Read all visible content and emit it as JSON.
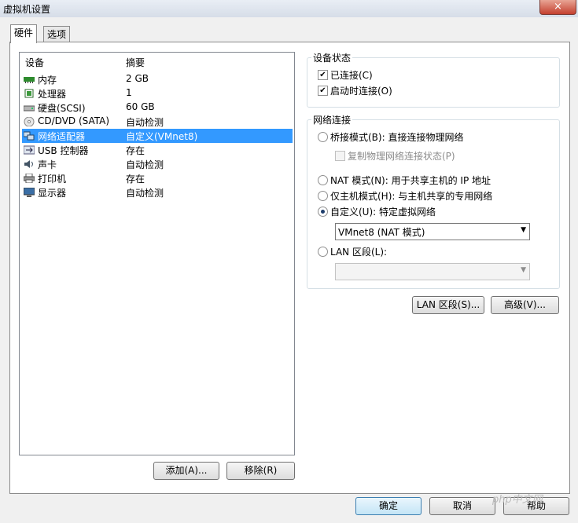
{
  "window": {
    "title": "虚拟机设置",
    "close_icon": "×"
  },
  "tabs": [
    {
      "label": "硬件",
      "active": true
    },
    {
      "label": "选项",
      "active": false
    }
  ],
  "device_list": {
    "headers": {
      "device": "设备",
      "summary": "摘要"
    },
    "rows": [
      {
        "icon": "memory-icon",
        "name": "内存",
        "summary": "2 GB"
      },
      {
        "icon": "processor-icon",
        "name": "处理器",
        "summary": "1"
      },
      {
        "icon": "harddisk-icon",
        "name": "硬盘(SCSI)",
        "summary": "60 GB"
      },
      {
        "icon": "cd-dvd-icon",
        "name": "CD/DVD (SATA)",
        "summary": "自动检测"
      },
      {
        "icon": "network-adapter-icon",
        "name": "网络适配器",
        "summary": "自定义(VMnet8)",
        "selected": true
      },
      {
        "icon": "usb-icon",
        "name": "USB 控制器",
        "summary": "存在"
      },
      {
        "icon": "sound-card-icon",
        "name": "声卡",
        "summary": "自动检测"
      },
      {
        "icon": "printer-icon",
        "name": "打印机",
        "summary": "存在"
      },
      {
        "icon": "display-icon",
        "name": "显示器",
        "summary": "自动检测"
      }
    ],
    "add_label": "添加(A)...",
    "remove_label": "移除(R)"
  },
  "device_status": {
    "group_label": "设备状态",
    "connected": {
      "label": "已连接(C)",
      "checked": true
    },
    "connect_at_power_on": {
      "label": "启动时连接(O)",
      "checked": true
    }
  },
  "network_connection": {
    "group_label": "网络连接",
    "bridged": {
      "label": "桥接模式(B): 直接连接物理网络",
      "selected": false
    },
    "replicate": {
      "label": "复制物理网络连接状态(P)",
      "checked": false
    },
    "nat": {
      "label": "NAT 模式(N): 用于共享主机的 IP 地址",
      "selected": false
    },
    "host_only": {
      "label": "仅主机模式(H): 与主机共享的专用网络",
      "selected": false
    },
    "custom": {
      "label": "自定义(U): 特定虚拟网络",
      "selected": true
    },
    "custom_value": "VMnet8 (NAT 模式)",
    "lan_segment": {
      "label": "LAN 区段(L):",
      "selected": false
    },
    "lan_value": ""
  },
  "buttons": {
    "lan_segments": "LAN 区段(S)...",
    "advanced": "高级(V)...",
    "ok": "确定",
    "cancel": "取消",
    "help": "帮助"
  },
  "watermark": "php中文网",
  "colors": {
    "selection": "#3399ff",
    "memory_icon": "#2e8b2e"
  }
}
